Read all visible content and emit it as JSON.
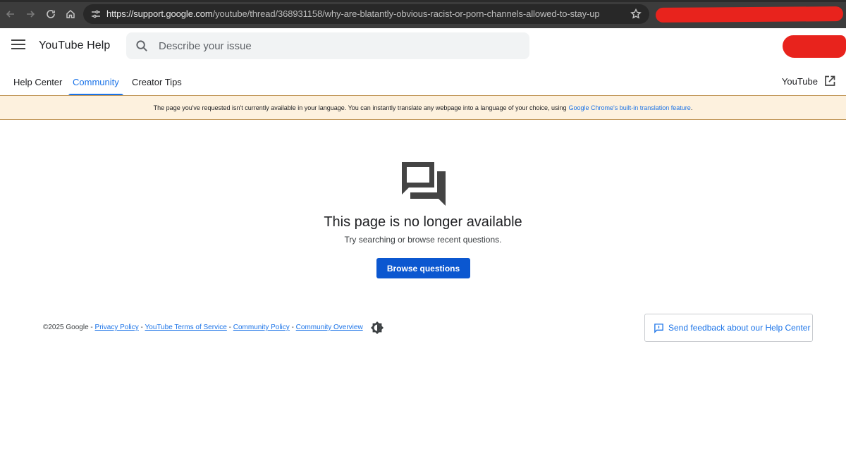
{
  "browser": {
    "url_host": "https://support.google.com",
    "url_path": "/youtube/thread/368931158/why-are-blatantly-obvious-racist-or-porn-channels-allowed-to-stay-up"
  },
  "header": {
    "product_name": "YouTube Help",
    "search_placeholder": "Describe your issue"
  },
  "tabs": [
    {
      "label": "Help Center"
    },
    {
      "label": "Community"
    },
    {
      "label": "Creator Tips"
    }
  ],
  "external_link": {
    "label": "YouTube"
  },
  "banner": {
    "text": "The page you've requested isn't currently available in your language. You can instantly translate any webpage into a language of your choice, using",
    "link": "Google Chrome's built-in translation feature",
    "suffix": "."
  },
  "main": {
    "title": "This page is no longer available",
    "subtitle": "Try searching or browse recent questions.",
    "button": "Browse questions"
  },
  "footer": {
    "copyright": "©2025 Google",
    "sep": " - ",
    "links": [
      "Privacy Policy",
      "YouTube Terms of Service",
      "Community Policy",
      "Community Overview"
    ],
    "feedback": "Send feedback about our Help Center"
  },
  "colors": {
    "accent": "#1a73e8",
    "button": "#0b57d0",
    "banner_bg": "#fdf1de",
    "redaction": "#e8231d"
  }
}
